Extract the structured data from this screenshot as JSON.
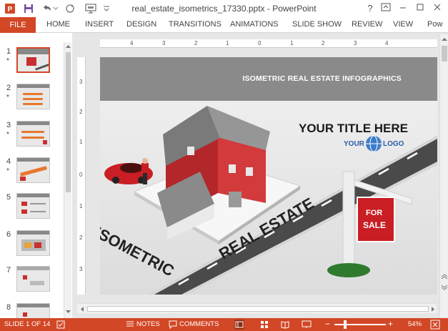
{
  "window": {
    "title": "real_estate_isometrics_17330.pptx - PowerPoint",
    "help_label": "?",
    "colors": {
      "accent": "#d24726",
      "header_gray": "#8a8a8a"
    }
  },
  "ribbon": {
    "tabs": [
      "FILE",
      "HOME",
      "INSERT",
      "DESIGN",
      "TRANSITIONS",
      "ANIMATIONS",
      "SLIDE SHOW",
      "REVIEW",
      "VIEW",
      "Pow"
    ]
  },
  "thumbnails": [
    {
      "num": "1",
      "star": "*"
    },
    {
      "num": "2",
      "star": "*"
    },
    {
      "num": "3",
      "star": "*"
    },
    {
      "num": "4",
      "star": "*"
    },
    {
      "num": "5",
      "star": ""
    },
    {
      "num": "6",
      "star": ""
    },
    {
      "num": "7",
      "star": ""
    },
    {
      "num": "8",
      "star": ""
    }
  ],
  "ruler": {
    "h_labels": [
      "4",
      "3",
      "2",
      "1",
      "0",
      "1",
      "2",
      "3",
      "4"
    ],
    "v_labels": [
      "3",
      "2",
      "1",
      "0",
      "1",
      "2",
      "3"
    ]
  },
  "slide": {
    "header": "ISOMETRIC REAL ESTATE INFOGRAPHICS",
    "title": "YOUR TITLE HERE",
    "logo_left": "YOUR",
    "logo_right": "LOGO",
    "word_left": "ISOMETRIC",
    "word_right": "REAL ESTATE",
    "sign_line1": "FOR",
    "sign_line2": "SALE"
  },
  "status": {
    "slide_info": "SLIDE 1 OF 14",
    "notes": "NOTES",
    "comments": "COMMENTS",
    "zoom": "54%"
  }
}
